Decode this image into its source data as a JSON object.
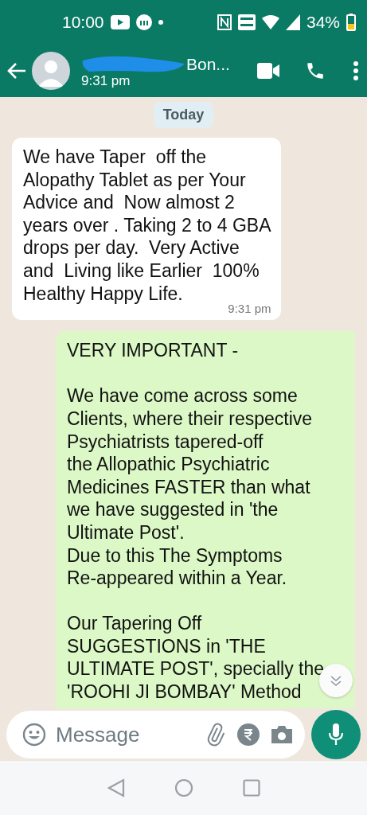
{
  "status_bar": {
    "time": "10:00",
    "battery": "34%"
  },
  "header": {
    "contact_name": "Bon...",
    "last_seen": "9:31 pm"
  },
  "date_chip": "Today",
  "messages": [
    {
      "kind": "received",
      "text": "We have Taper  off the\nAlopathy Tablet as per Your\nAdvice and  Now almost 2\nyears over . Taking 2 to 4 GBA\ndrops per day.  Very Active\nand  Living like Earlier  100%\nHealthy Happy Life.",
      "time": "9:31 pm"
    },
    {
      "kind": "sent",
      "text": "VERY IMPORTANT -\n\nWe have come across some\nClients, where their respective\nPsychiatrists tapered-off\nthe Allopathic Psychiatric\nMedicines FASTER than what\nwe have suggested in 'the\nUltimate Post'.\nDue to this The Symptoms\nRe-appeared within a Year.\n\nOur Tapering Off\nSUGGESTIONS in 'THE\nULTIMATE POST', specially the\n'ROOHI JI BOMBAY' Method"
    }
  ],
  "composer": {
    "placeholder": "Message"
  }
}
